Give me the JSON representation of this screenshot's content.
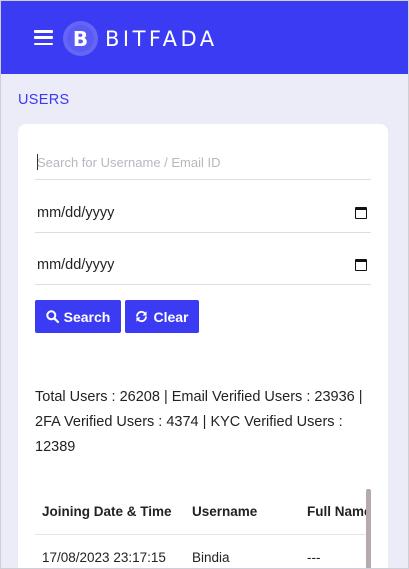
{
  "app": {
    "brand_name": "BITFADA",
    "brand_glyph": "B",
    "menu_icon": "hamburger-menu-icon",
    "accent_color": "#3b3bf3"
  },
  "page": {
    "title": "USERS"
  },
  "filters": {
    "search_placeholder": "Search for Username / Email ID",
    "search_value": "",
    "start_date_display": "mm/dd/yyyy",
    "end_date_display": "mm/dd/yyyy",
    "calendar_icon": "calendar-icon",
    "search_label": "Search",
    "search_icon": "magnifier-icon",
    "clear_label": "Clear",
    "clear_icon": "refresh-icon"
  },
  "stats": {
    "text": "Total Users : 26208 | Email Verified Users : 23936 | 2FA Verified Users : 4374 | KYC Verified Users : 12389"
  },
  "table": {
    "columns": [
      "Joining Date & Time",
      "Username",
      "Full Name"
    ],
    "rows": [
      [
        "17/08/2023 23:17:15",
        "Bindia",
        "---"
      ]
    ]
  }
}
